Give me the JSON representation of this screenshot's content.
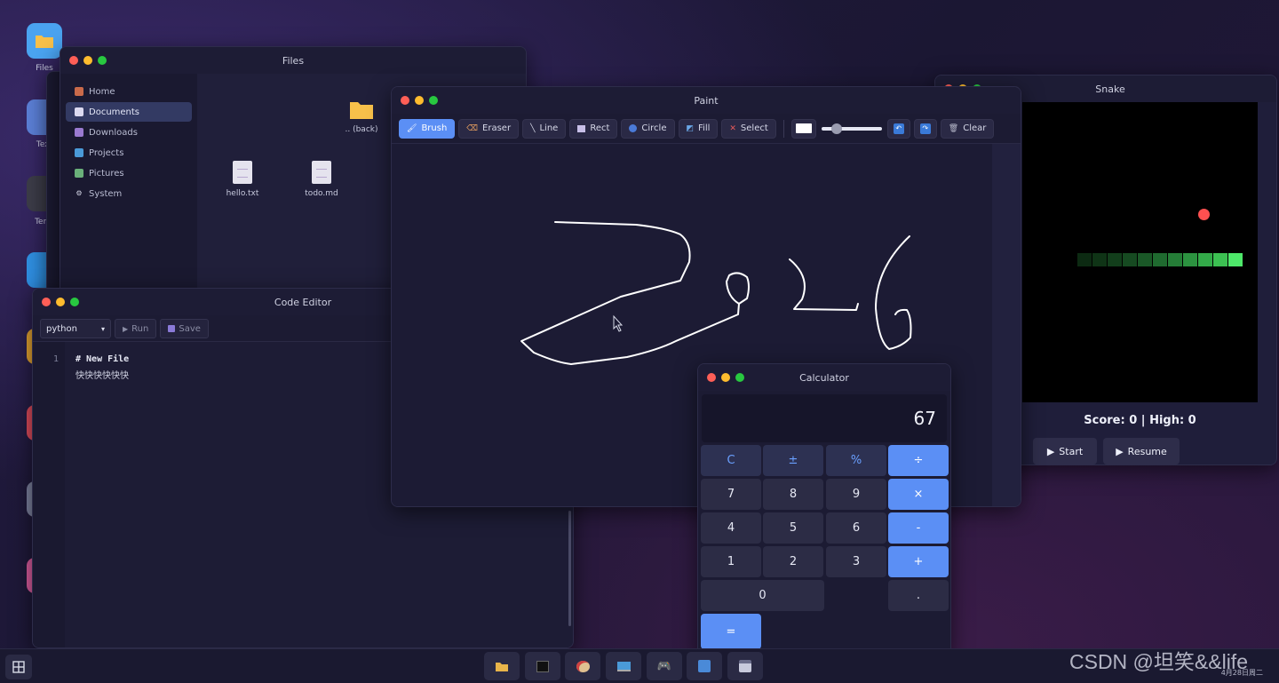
{
  "desktop": {
    "icons": [
      {
        "label": "Files",
        "icon": "folder-icon",
        "color": "#4aa3f0"
      },
      {
        "label": "Text",
        "icon": "text-editor-icon",
        "color": "#5b7fd6"
      },
      {
        "label": "Term",
        "icon": "terminal-icon",
        "color": "#3c3c48"
      },
      {
        "label": "",
        "icon": "code-editor-icon",
        "color": "#2f8ee0"
      },
      {
        "label": "",
        "icon": "app-icon",
        "color": "#e0a030"
      },
      {
        "label": "",
        "icon": "app-icon",
        "color": "#d94a5a"
      },
      {
        "label": "C",
        "icon": "calculator-icon",
        "color": "#7b7f9c"
      },
      {
        "label": "C",
        "icon": "app-icon",
        "color": "#d45a9a"
      }
    ]
  },
  "files": {
    "title": "Files",
    "sidebar": [
      {
        "label": "Home",
        "icon": "home-icon",
        "active": false
      },
      {
        "label": "Documents",
        "icon": "document-icon",
        "active": true
      },
      {
        "label": "Downloads",
        "icon": "download-icon",
        "active": false
      },
      {
        "label": "Projects",
        "icon": "laptop-icon",
        "active": false
      },
      {
        "label": "Pictures",
        "icon": "picture-icon",
        "active": false
      },
      {
        "label": "System",
        "icon": "gear-icon",
        "active": false
      }
    ],
    "items": [
      {
        "name": ".. (back)",
        "kind": "folder"
      },
      {
        "name": "hello.txt",
        "kind": "file"
      },
      {
        "name": "todo.md",
        "kind": "file"
      }
    ]
  },
  "code_editor": {
    "title": "Code Editor",
    "language": "python",
    "run_label": "Run",
    "save_label": "Save",
    "line_numbers": [
      "1",
      ""
    ],
    "lines": [
      "# New File",
      "快快快快快快"
    ]
  },
  "paint": {
    "title": "Paint",
    "tools": [
      {
        "label": "Brush",
        "icon": "brush-icon",
        "active": true
      },
      {
        "label": "Eraser",
        "icon": "eraser-icon",
        "active": false
      },
      {
        "label": "Line",
        "icon": "line-icon",
        "active": false
      },
      {
        "label": "Rect",
        "icon": "rect-icon",
        "active": false
      },
      {
        "label": "Circle",
        "icon": "circle-icon",
        "active": false
      },
      {
        "label": "Fill",
        "icon": "fill-icon",
        "active": false
      },
      {
        "label": "Select",
        "icon": "select-icon",
        "active": false
      }
    ],
    "color_swatch": "#ffffff",
    "brush_size": 0.25,
    "clear_label": "Clear",
    "stroke_color": "#ffffff"
  },
  "snake": {
    "title": "Snake",
    "score_text": "Score: 0 | High: 0",
    "start_label": "Start",
    "resume_label": "Resume",
    "food_color": "#ff5050",
    "snake_color": "#3ddc5a"
  },
  "calculator": {
    "title": "Calculator",
    "display": "67",
    "keys": [
      "C",
      "±",
      "%",
      "÷",
      "7",
      "8",
      "9",
      "×",
      "4",
      "5",
      "6",
      "-",
      "1",
      "2",
      "3",
      "+",
      "0",
      ".",
      "="
    ]
  },
  "taskbar": {
    "start_icon": "grid-icon",
    "apps": [
      "folder-icon",
      "terminal-icon",
      "palette-icon",
      "laptop-icon",
      "gamepad-icon",
      "calculator-icon",
      "calendar-icon"
    ],
    "date": "4月28日周二"
  },
  "watermark": "CSDN @坦笑&&life"
}
